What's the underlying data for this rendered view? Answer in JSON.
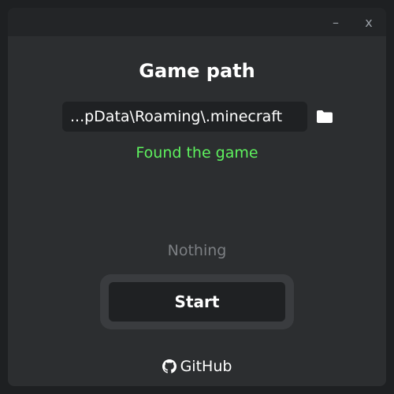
{
  "window": {
    "minimize_label": "–",
    "close_label": "x"
  },
  "title": "Game path",
  "path_input": {
    "value": "...pData\\Roaming\\.minecraft",
    "folder_icon": "folder-icon"
  },
  "status": {
    "text": "Found the game",
    "color": "#5ef25e"
  },
  "message": "Nothing",
  "start_label": "Start",
  "github": {
    "label": "GitHub",
    "icon": "github-icon"
  }
}
